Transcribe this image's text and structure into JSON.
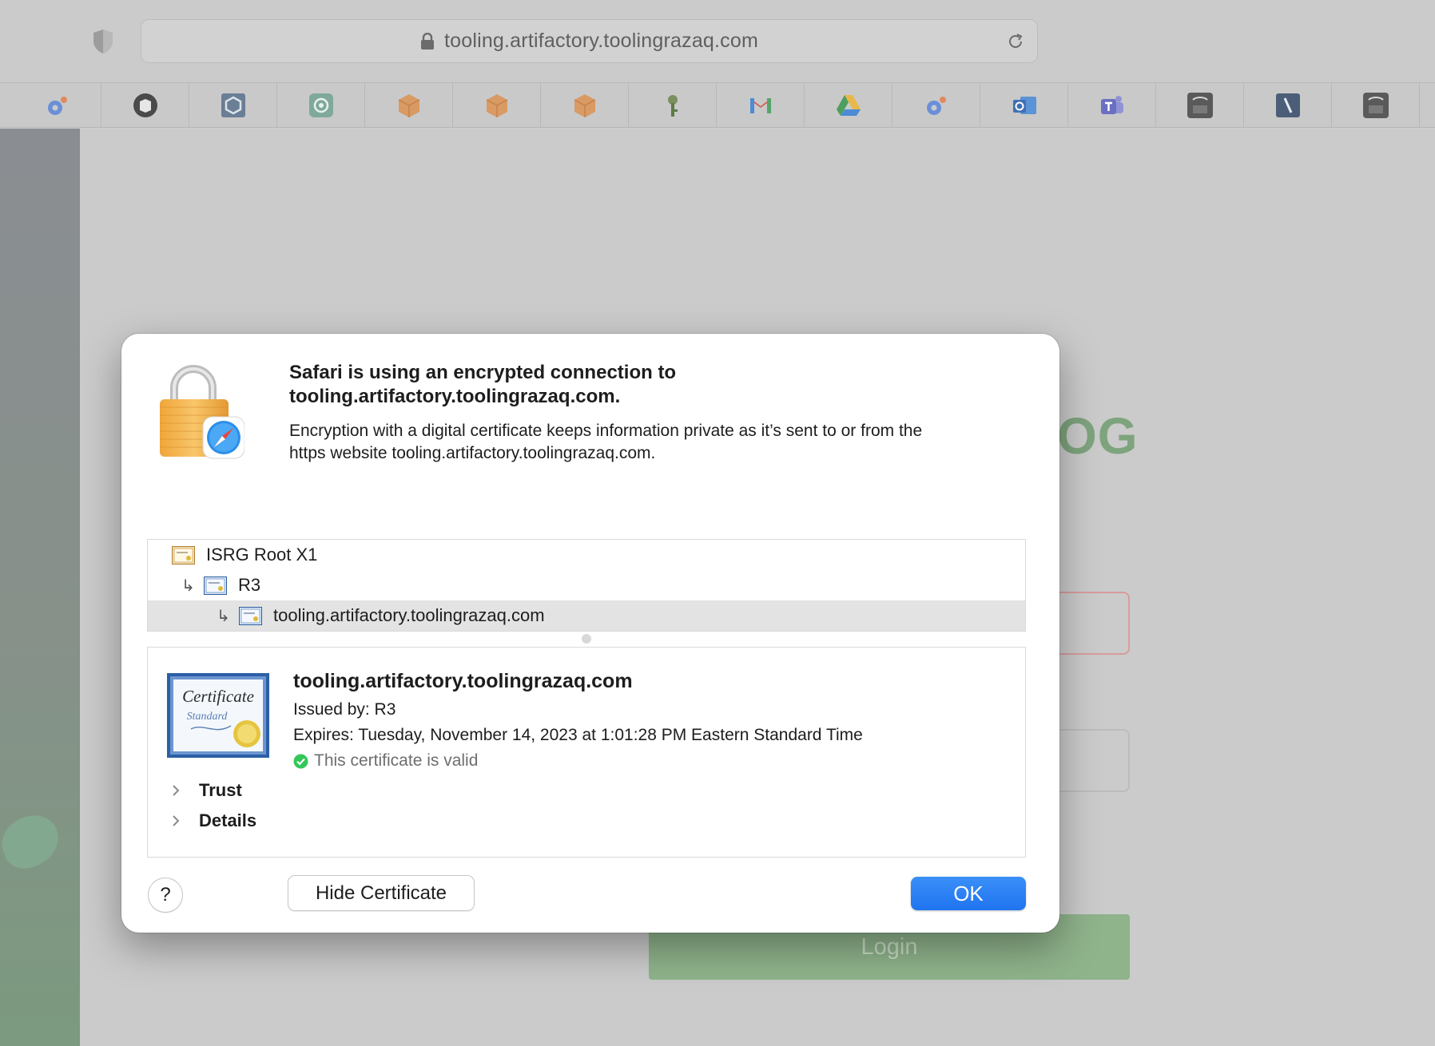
{
  "browser": {
    "address_url": "tooling.artifactory.toolingrazaq.com",
    "favorites": [
      {
        "icon": "swirl-app-icon",
        "color": "#6b8fd8"
      },
      {
        "icon": "book-circle-icon",
        "color": "#4a4a4a"
      },
      {
        "icon": "hexagon-icon",
        "color": "#6a7e95"
      },
      {
        "icon": "openai-icon",
        "color": "#7fa99a"
      },
      {
        "icon": "package-icon",
        "color": "#d99a63"
      },
      {
        "icon": "package-icon",
        "color": "#d99a63"
      },
      {
        "icon": "package-icon",
        "color": "#d99a63"
      },
      {
        "icon": "key-icon",
        "color": "#5e7a48"
      },
      {
        "icon": "gmail-icon",
        "color": "#d35b4e"
      },
      {
        "icon": "google-drive-icon",
        "color": "#4c8bd6"
      },
      {
        "icon": "swirl-app-icon",
        "color": "#6b8fd8"
      },
      {
        "icon": "outlook-icon",
        "color": "#3f6fb6"
      },
      {
        "icon": "teams-icon",
        "color": "#6a6fc2"
      },
      {
        "icon": "jfrog-icon",
        "color": "#5a5a5a"
      },
      {
        "icon": "slash-app-icon",
        "color": "#4c5d78"
      },
      {
        "icon": "jfrog-icon",
        "color": "#5a5a5a"
      }
    ]
  },
  "page": {
    "logo_fragment": "OG",
    "login_label": "Login"
  },
  "dialog": {
    "title_line1": "Safari is using an encrypted connection to",
    "title_line2": "tooling.artifactory.toolingrazaq.com.",
    "description_line1": "Encryption with a digital certificate keeps information private as it’s sent to or from the",
    "description_line2": "https website tooling.artifactory.toolingrazaq.com.",
    "chain": [
      {
        "label": "ISRG Root X1",
        "level": 0,
        "selected": false
      },
      {
        "label": "R3",
        "level": 1,
        "selected": false
      },
      {
        "label": "tooling.artifactory.toolingrazaq.com",
        "level": 2,
        "selected": true
      }
    ],
    "certificate": {
      "host": "tooling.artifactory.toolingrazaq.com",
      "issued_by": "Issued by: R3",
      "expires": "Expires: Tuesday, November 14, 2023 at 1:01:28 PM Eastern Standard Time",
      "status": "This certificate is valid",
      "status_color": "#34c759",
      "image_text_1": "Certificate",
      "image_text_2": "Standard"
    },
    "sections": [
      "Trust",
      "Details"
    ],
    "help_label": "?",
    "hide_label": "Hide Certificate",
    "ok_label": "OK",
    "accent": "#1f74f0"
  }
}
